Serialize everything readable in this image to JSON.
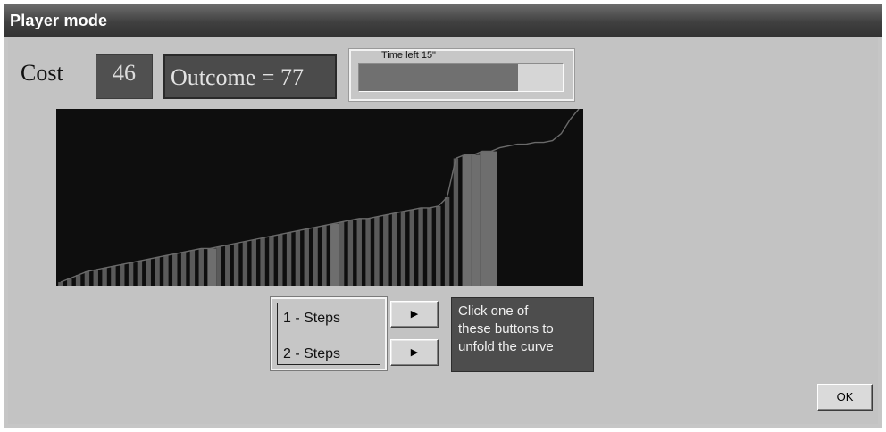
{
  "window": {
    "title": "Player mode"
  },
  "cost": {
    "label": "Cost",
    "value": "46"
  },
  "outcome": {
    "text": "Outcome = 77"
  },
  "timer": {
    "label": "Time left  15\"",
    "remaining_fraction": 0.78
  },
  "steps": {
    "step1_label": "1 - Steps",
    "step2_label": "2 - Steps"
  },
  "hint": {
    "lines": [
      "Click one of",
      "these buttons to",
      "unfold the curve"
    ]
  },
  "buttons": {
    "ok_label": "OK",
    "play_icon": "play-arrow-icon"
  },
  "colors": {
    "chart_bg": "#0e0e0e",
    "bar": "#5a5a5a",
    "bar_highlight": "#6e6e6e",
    "curve": "#6a6a6a"
  },
  "chart_data": {
    "type": "bar",
    "bar_count": 60,
    "revealed_bar_count": 50,
    "highlighted_bars": [
      17,
      31,
      46,
      47,
      48,
      49
    ],
    "bar_levels": [
      0.02,
      0.04,
      0.06,
      0.08,
      0.09,
      0.1,
      0.11,
      0.12,
      0.13,
      0.14,
      0.15,
      0.16,
      0.17,
      0.18,
      0.19,
      0.2,
      0.21,
      0.21,
      0.22,
      0.23,
      0.24,
      0.25,
      0.26,
      0.27,
      0.28,
      0.29,
      0.3,
      0.31,
      0.32,
      0.33,
      0.34,
      0.35,
      0.36,
      0.37,
      0.38,
      0.38,
      0.39,
      0.4,
      0.41,
      0.42,
      0.43,
      0.44,
      0.44,
      0.45,
      0.5,
      0.72,
      0.74,
      0.74,
      0.76,
      0.76,
      0.78,
      0.79,
      0.8,
      0.8,
      0.81,
      0.81,
      0.82,
      0.86,
      0.94,
      1.0
    ]
  }
}
